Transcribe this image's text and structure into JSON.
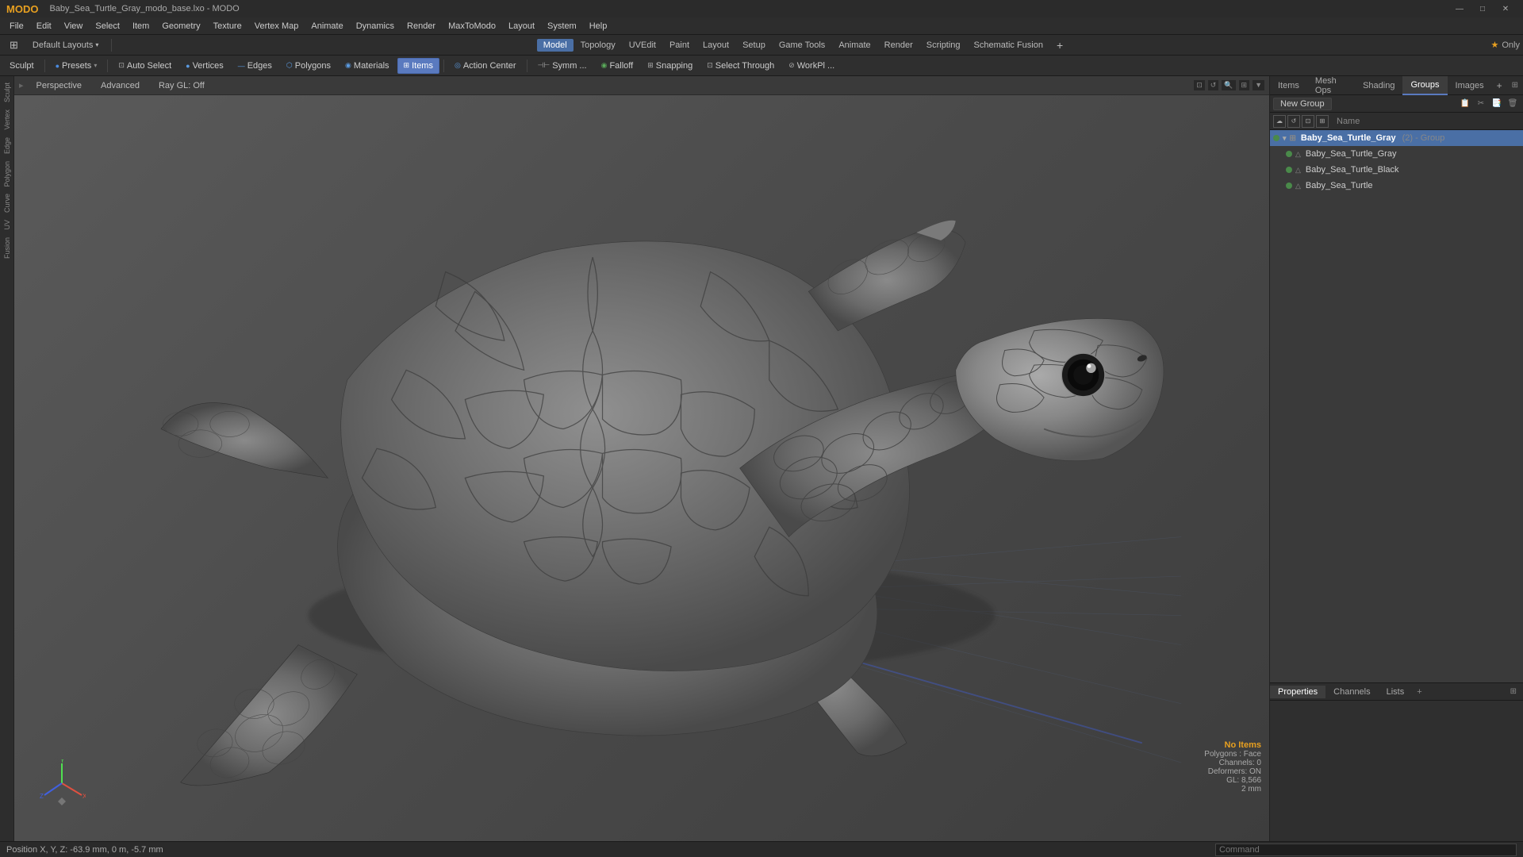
{
  "window": {
    "title": "Baby_Sea_Turtle_Gray_modo_base.lxo - MODO",
    "logo": "MODO"
  },
  "titlebar": {
    "title": "Baby_Sea_Turtle_Gray_modo_base.lxo - MODO",
    "minimize": "—",
    "maximize": "□",
    "close": "✕"
  },
  "menubar": {
    "items": [
      "File",
      "Edit",
      "View",
      "Select",
      "Item",
      "Geometry",
      "Texture",
      "Vertex Map",
      "Animate",
      "Dynamics",
      "Render",
      "MaxToModo",
      "Layout",
      "System",
      "Help"
    ]
  },
  "layout_bar": {
    "left_label": "⊞",
    "preset": "Default Layouts",
    "preset_arrow": "▾",
    "star_icon": "★",
    "only_label": "Only",
    "tabs": [
      {
        "id": "model",
        "label": "Model",
        "active": true
      },
      {
        "id": "topology",
        "label": "Topology"
      },
      {
        "id": "uvedit",
        "label": "UVEdit"
      },
      {
        "id": "paint",
        "label": "Paint"
      },
      {
        "id": "layout",
        "label": "Layout"
      },
      {
        "id": "setup",
        "label": "Setup"
      },
      {
        "id": "game_tools",
        "label": "Game Tools"
      },
      {
        "id": "animate",
        "label": "Animate"
      },
      {
        "id": "render",
        "label": "Render"
      },
      {
        "id": "scripting",
        "label": "Scripting"
      },
      {
        "id": "schematic_fusion",
        "label": "Schematic Fusion"
      }
    ],
    "add_icon": "+"
  },
  "toolbar": {
    "sculpt": "Sculpt",
    "presets": "Presets",
    "presets_icon": "🔵",
    "auto_select": "Auto Select",
    "vertices": "Vertices",
    "edges": "Edges",
    "polygons": "Polygons",
    "materials": "Materials",
    "items": "Items",
    "action_center": "Action Center",
    "symmetry": "Symm ...",
    "falloff": "Falloff",
    "snapping": "Snapping",
    "select_through": "Select Through",
    "workplane": "WorkPl ..."
  },
  "viewport": {
    "mode": "Perspective",
    "advanced": "Advanced",
    "ray_gl": "Ray GL: Off",
    "icons": [
      "⊡",
      "↺",
      "🔍",
      "⊞",
      "▼"
    ]
  },
  "viewport_info": {
    "no_items": "No Items",
    "polygons": "Polygons : Face",
    "channels": "Channels: 0",
    "deformers": "Deformers: ON",
    "gl": "GL: 8,566",
    "size": "2 mm"
  },
  "statusbar": {
    "position": "Position X, Y, Z:  -63.9 mm, 0 m, -5.7 mm",
    "command_placeholder": "Command"
  },
  "right_panel": {
    "tabs": [
      "Items",
      "Mesh Ops",
      "Shading",
      "Groups",
      "Images"
    ],
    "active_tab": "Groups",
    "add_icon": "+",
    "expand_icon": "⊞"
  },
  "groups_toolbar": {
    "new_group_label": "New Group",
    "icons": [
      "📋",
      "✂",
      "📑",
      "🗑"
    ]
  },
  "groups_header": {
    "name_col": "Name"
  },
  "groups_tree": {
    "items": [
      {
        "id": "group1",
        "label": "Baby_Sea_Turtle_Gray",
        "suffix": "(2) - Group",
        "type": "group",
        "expanded": true,
        "color": "#4a8a4a",
        "indent": 0
      },
      {
        "id": "item1",
        "label": "Baby_Sea_Turtle_Gray",
        "type": "mesh",
        "color": "#4a8a4a",
        "indent": 1
      },
      {
        "id": "item2",
        "label": "Baby_Sea_Turtle_Black",
        "type": "mesh",
        "color": "#4a8a4a",
        "indent": 1
      },
      {
        "id": "item3",
        "label": "Baby_Sea_Turtle",
        "type": "mesh",
        "color": "#4a8a4a",
        "indent": 1
      }
    ]
  },
  "bottom_panel": {
    "tabs": [
      "Properties",
      "Channels",
      "Lists"
    ],
    "active_tab": "Properties",
    "add_icon": "+"
  },
  "left_sidebar": {
    "labels": [
      "Sculpt",
      "Vertex",
      "Edge",
      "Polygon",
      "Curve",
      "UV",
      "Fusion"
    ]
  }
}
